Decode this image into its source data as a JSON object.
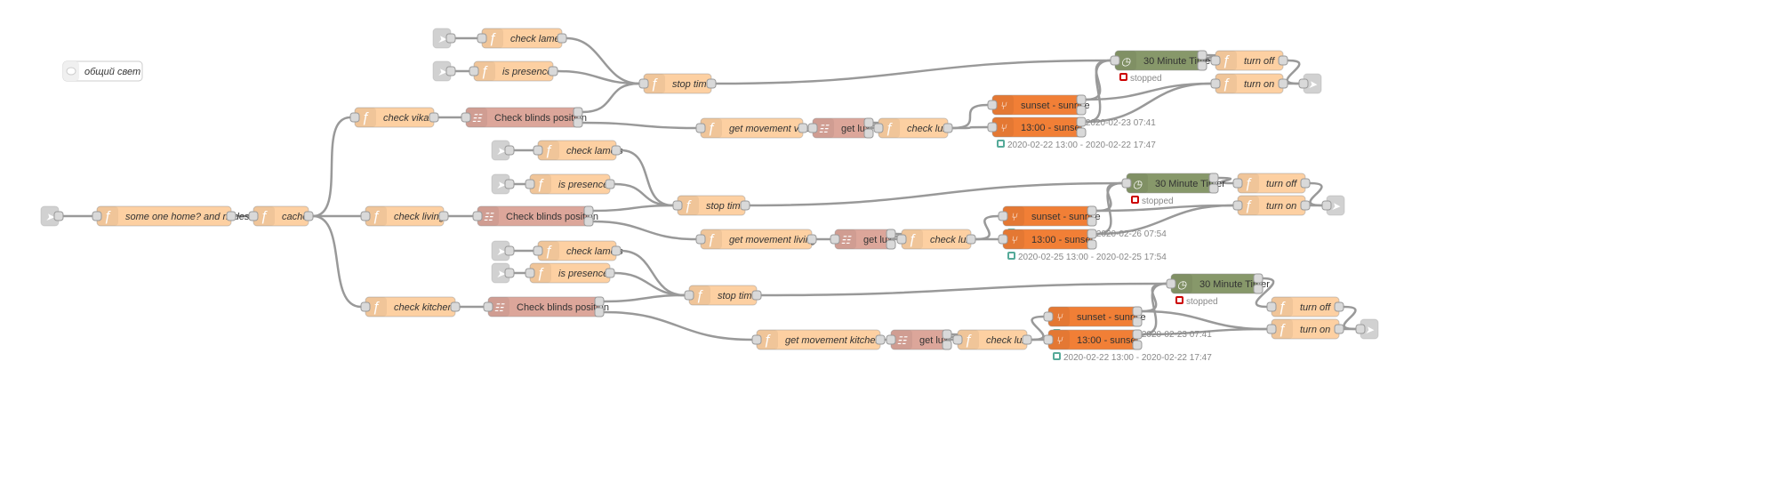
{
  "colors": {
    "function": "#fdd0a2",
    "blinds": "#dca69a",
    "timer": "#87986a",
    "timerange": "#f17f36",
    "inject": "#dddddd",
    "status_ok": "#5a9",
    "status_stopped": "#c00",
    "wire": "#999999"
  },
  "comment": {
    "label": "общий свет",
    "icon": "comment-icon"
  },
  "nodes": [
    {
      "id": "root_in",
      "type": "link",
      "label": ""
    },
    {
      "id": "someone",
      "type": "function",
      "label": "some one home? and nodes"
    },
    {
      "id": "cache",
      "type": "function",
      "label": "cache"
    },
    {
      "id": "v_in1",
      "type": "link",
      "label": ""
    },
    {
      "id": "v_lamels",
      "type": "function",
      "label": "check lamels"
    },
    {
      "id": "v_in2",
      "type": "link",
      "label": ""
    },
    {
      "id": "v_pres",
      "type": "function",
      "label": "is presence"
    },
    {
      "id": "v_check",
      "type": "function",
      "label": "check vika"
    },
    {
      "id": "v_blinds",
      "type": "blinds",
      "label": "Check blinds position"
    },
    {
      "id": "v_stop",
      "type": "function",
      "label": "stop timer"
    },
    {
      "id": "v_move",
      "type": "function",
      "label": "get movement vika"
    },
    {
      "id": "v_lux",
      "type": "blinds",
      "label": "get lux"
    },
    {
      "id": "v_clux",
      "type": "function",
      "label": "check lux"
    },
    {
      "id": "v_ss",
      "type": "timerange",
      "label": "sunset - sunrise",
      "status": "2020-02-22 17:47 - 2020-02-23 07:41"
    },
    {
      "id": "v_13",
      "type": "timerange",
      "label": "13:00 - sunset",
      "status": "2020-02-22 13:00 - 2020-02-22 17:47"
    },
    {
      "id": "v_timer",
      "type": "timer",
      "label": "30 Minute Timer",
      "status": "stopped"
    },
    {
      "id": "v_off",
      "type": "function",
      "label": "turn off"
    },
    {
      "id": "v_on",
      "type": "function",
      "label": "turn on"
    },
    {
      "id": "v_out",
      "type": "link",
      "label": ""
    },
    {
      "id": "l_in1",
      "type": "link",
      "label": ""
    },
    {
      "id": "l_lamels",
      "type": "function",
      "label": "check lamels"
    },
    {
      "id": "l_in2",
      "type": "link",
      "label": ""
    },
    {
      "id": "l_pres",
      "type": "function",
      "label": "is presence"
    },
    {
      "id": "l_check",
      "type": "function",
      "label": "check living"
    },
    {
      "id": "l_blinds",
      "type": "blinds",
      "label": "Check blinds position"
    },
    {
      "id": "l_stop",
      "type": "function",
      "label": "stop timer"
    },
    {
      "id": "l_move",
      "type": "function",
      "label": "get movement living"
    },
    {
      "id": "l_lux",
      "type": "blinds",
      "label": "get lux"
    },
    {
      "id": "l_clux",
      "type": "function",
      "label": "check lux"
    },
    {
      "id": "l_ss",
      "type": "timerange",
      "label": "sunset - sunrise",
      "status": "2020-02-25 17:54 - 2020-02-26 07:54"
    },
    {
      "id": "l_13",
      "type": "timerange",
      "label": "13:00 - sunset",
      "status": "2020-02-25 13:00 - 2020-02-25 17:54"
    },
    {
      "id": "l_timer",
      "type": "timer",
      "label": "30 Minute Timer",
      "status": "stopped"
    },
    {
      "id": "l_off",
      "type": "function",
      "label": "turn off"
    },
    {
      "id": "l_on",
      "type": "function",
      "label": "turn on"
    },
    {
      "id": "l_out",
      "type": "link",
      "label": ""
    },
    {
      "id": "k_in1",
      "type": "link",
      "label": ""
    },
    {
      "id": "k_lamels",
      "type": "function",
      "label": "check lamels"
    },
    {
      "id": "k_in2",
      "type": "link",
      "label": ""
    },
    {
      "id": "k_pres",
      "type": "function",
      "label": "is presence"
    },
    {
      "id": "k_check",
      "type": "function",
      "label": "check kitchen"
    },
    {
      "id": "k_blinds",
      "type": "blinds",
      "label": "Check blinds position"
    },
    {
      "id": "k_stop",
      "type": "function",
      "label": "stop timer"
    },
    {
      "id": "k_move",
      "type": "function",
      "label": "get movement kitchen"
    },
    {
      "id": "k_lux",
      "type": "blinds",
      "label": "get lux"
    },
    {
      "id": "k_clux",
      "type": "function",
      "label": "check lux"
    },
    {
      "id": "k_ss",
      "type": "timerange",
      "label": "sunset - sunrise",
      "status": "2020-02-22 17:47 - 2020-02-23 07:41"
    },
    {
      "id": "k_13",
      "type": "timerange",
      "label": "13:00 - sunset",
      "status": "2020-02-22 13:00 - 2020-02-22 17:47"
    },
    {
      "id": "k_timer",
      "type": "timer",
      "label": "30 Minute Timer",
      "status": "stopped"
    },
    {
      "id": "k_off",
      "type": "function",
      "label": "turn off"
    },
    {
      "id": "k_on",
      "type": "function",
      "label": "turn on"
    },
    {
      "id": "k_out",
      "type": "link",
      "label": ""
    }
  ],
  "wires": [
    [
      "root_in",
      "someone",
      0
    ],
    [
      "someone",
      "cache",
      0
    ],
    [
      "cache",
      "v_check",
      0
    ],
    [
      "cache",
      "l_check",
      0
    ],
    [
      "cache",
      "k_check",
      0
    ],
    [
      "v_in1",
      "v_lamels",
      0
    ],
    [
      "v_in2",
      "v_pres",
      0
    ],
    [
      "v_lamels",
      "v_stop",
      0
    ],
    [
      "v_pres",
      "v_stop",
      0
    ],
    [
      "v_check",
      "v_blinds",
      0
    ],
    [
      "v_blinds",
      "v_stop",
      0
    ],
    [
      "v_blinds",
      "v_move",
      1
    ],
    [
      "v_stop",
      "v_timer",
      0
    ],
    [
      "v_move",
      "v_lux",
      0
    ],
    [
      "v_lux",
      "v_clux",
      0
    ],
    [
      "v_clux",
      "v_ss",
      0
    ],
    [
      "v_clux",
      "v_13",
      0
    ],
    [
      "v_ss",
      "v_on",
      0
    ],
    [
      "v_ss",
      "v_timer",
      0
    ],
    [
      "v_13",
      "v_on",
      0
    ],
    [
      "v_13",
      "v_timer",
      0
    ],
    [
      "v_timer",
      "v_off",
      0
    ],
    [
      "v_off",
      "v_out",
      0
    ],
    [
      "v_on",
      "v_out",
      0
    ],
    [
      "l_in1",
      "l_lamels",
      0
    ],
    [
      "l_in2",
      "l_pres",
      0
    ],
    [
      "l_lamels",
      "l_stop",
      0
    ],
    [
      "l_pres",
      "l_stop",
      0
    ],
    [
      "l_check",
      "l_blinds",
      0
    ],
    [
      "l_blinds",
      "l_stop",
      0
    ],
    [
      "l_blinds",
      "l_move",
      1
    ],
    [
      "l_stop",
      "l_timer",
      0
    ],
    [
      "l_move",
      "l_lux",
      0
    ],
    [
      "l_lux",
      "l_clux",
      0
    ],
    [
      "l_clux",
      "l_ss",
      0
    ],
    [
      "l_clux",
      "l_13",
      0
    ],
    [
      "l_ss",
      "l_on",
      0
    ],
    [
      "l_ss",
      "l_timer",
      0
    ],
    [
      "l_13",
      "l_on",
      0
    ],
    [
      "l_13",
      "l_timer",
      0
    ],
    [
      "l_timer",
      "l_off",
      0
    ],
    [
      "l_off",
      "l_out",
      0
    ],
    [
      "l_on",
      "l_out",
      0
    ],
    [
      "k_in1",
      "k_lamels",
      0
    ],
    [
      "k_in2",
      "k_pres",
      0
    ],
    [
      "k_lamels",
      "k_stop",
      0
    ],
    [
      "k_pres",
      "k_stop",
      0
    ],
    [
      "k_check",
      "k_blinds",
      0
    ],
    [
      "k_blinds",
      "k_stop",
      0
    ],
    [
      "k_blinds",
      "k_move",
      1
    ],
    [
      "k_stop",
      "k_timer",
      0
    ],
    [
      "k_move",
      "k_lux",
      0
    ],
    [
      "k_lux",
      "k_clux",
      0
    ],
    [
      "k_clux",
      "k_ss",
      0
    ],
    [
      "k_clux",
      "k_13",
      0
    ],
    [
      "k_ss",
      "k_on",
      0
    ],
    [
      "k_ss",
      "k_timer",
      0
    ],
    [
      "k_13",
      "k_on",
      0
    ],
    [
      "k_13",
      "k_timer",
      0
    ],
    [
      "k_timer",
      "k_off",
      0
    ],
    [
      "k_off",
      "k_out",
      0
    ],
    [
      "k_on",
      "k_out",
      0
    ]
  ]
}
